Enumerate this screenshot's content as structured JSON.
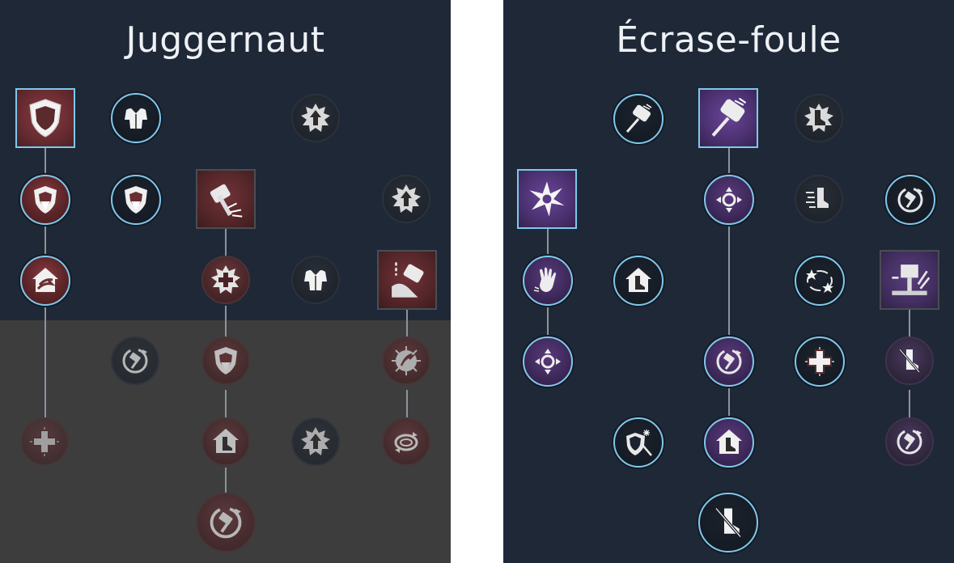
{
  "trees": {
    "left": {
      "title": "Juggernaut",
      "nodes": {
        "n1": {
          "icon": "shield-crack-icon",
          "state": "active"
        },
        "n2": {
          "icon": "armor-torso-icon",
          "state": "active"
        },
        "n3": {
          "icon": "star-arrow-up-icon",
          "state": "inactive"
        },
        "n4": {
          "icon": "shield-arrow-down-icon",
          "state": "active"
        },
        "n5": {
          "icon": "shield-arrow-down-icon",
          "state": "active"
        },
        "n6": {
          "icon": "hammer-ground-icon",
          "state": "inactive"
        },
        "n7": {
          "icon": "star-arrow-up-icon",
          "state": "inactive"
        },
        "n8": {
          "icon": "house-swirl-icon",
          "state": "active"
        },
        "n9": {
          "icon": "star-cross-icon",
          "state": "inactive"
        },
        "n10": {
          "icon": "armor-sparkle-icon",
          "state": "inactive"
        },
        "n11": {
          "icon": "chain-hammer-icon",
          "state": "inactive"
        },
        "n12": {
          "icon": "hammer-cycle-icon",
          "state": "locked"
        },
        "n13": {
          "icon": "shield-arrow-down-icon",
          "state": "locked"
        },
        "n14": {
          "icon": "burst-swirl-icon",
          "state": "locked"
        },
        "n15": {
          "icon": "medic-cross-icon",
          "state": "locked"
        },
        "n16": {
          "icon": "house-boot-icon",
          "state": "locked"
        },
        "n17": {
          "icon": "star-arrow-up-icon",
          "state": "locked"
        },
        "n18": {
          "icon": "ring-cycle-icon",
          "state": "locked"
        },
        "n19": {
          "icon": "hammer-cycle-icon",
          "state": "locked"
        }
      }
    },
    "right": {
      "title": "Écrase-foule",
      "nodes": {
        "m1": {
          "icon": "hammer-strike-icon",
          "state": "active"
        },
        "m2": {
          "icon": "hammer-strike-icon",
          "state": "active"
        },
        "m3": {
          "icon": "star-boot-icon",
          "state": "inactive"
        },
        "m4": {
          "icon": "shatter-burst-icon",
          "state": "active"
        },
        "m5": {
          "icon": "arrows-burst-icon",
          "state": "active"
        },
        "m6": {
          "icon": "dash-boot-icon",
          "state": "inactive"
        },
        "m7": {
          "icon": "hammer-cycle-icon",
          "state": "active"
        },
        "m8": {
          "icon": "grab-hand-icon",
          "state": "active"
        },
        "m9": {
          "icon": "house-boot-icon",
          "state": "active"
        },
        "m10": {
          "icon": "star-orbit-icon",
          "state": "active"
        },
        "m11": {
          "icon": "hammer-slam-icon",
          "state": "inactive"
        },
        "m12": {
          "icon": "arrows-burst-icon",
          "state": "active"
        },
        "m13": {
          "icon": "hammer-cycle-icon",
          "state": "active"
        },
        "m14": {
          "icon": "medic-cross-icon",
          "state": "active"
        },
        "m15": {
          "icon": "boot-slash-icon",
          "state": "inactive"
        },
        "m16": {
          "icon": "shield-sword-frost-icon",
          "state": "active"
        },
        "m17": {
          "icon": "house-boot-icon",
          "state": "active"
        },
        "m18": {
          "icon": "hammer-cycle-icon",
          "state": "inactive"
        },
        "m19": {
          "icon": "boot-slash-icon",
          "state": "active"
        }
      }
    }
  },
  "colors": {
    "panel_bg": "#1f2836",
    "locked_bg": "#3d3d3d",
    "active_ring": "#7fc8ec",
    "juggernaut_accent": "#6b2d32",
    "crusher_accent": "#4f3375",
    "link": "#8d939b"
  }
}
